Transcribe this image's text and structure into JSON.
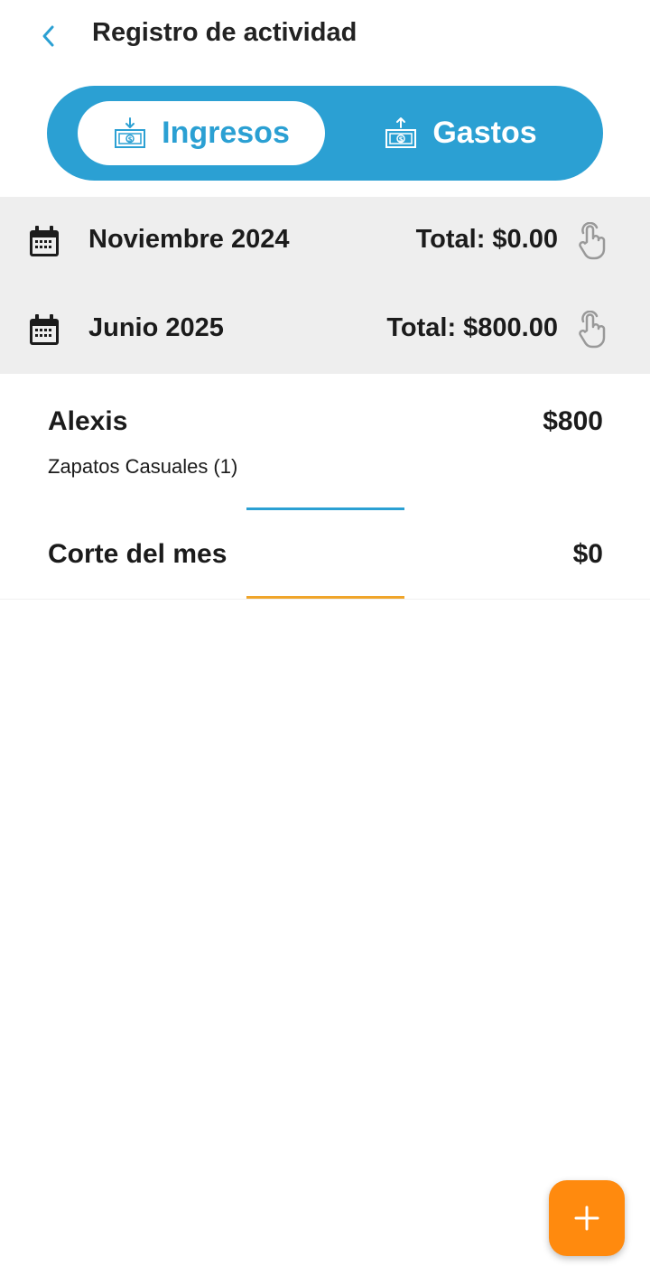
{
  "header": {
    "title": "Registro de actividad",
    "back_icon": "chevron-left-icon"
  },
  "segmented": {
    "active_tab": "Ingresos",
    "tabs": [
      {
        "label": "Ingresos",
        "icon": "money-in-icon",
        "active": true
      },
      {
        "label": "Gastos",
        "icon": "money-out-icon",
        "active": false
      }
    ]
  },
  "months": [
    {
      "name": "Noviembre 2024",
      "total": "Total: $0.00"
    },
    {
      "name": "Junio 2025",
      "total": "Total: $800.00"
    }
  ],
  "entries": [
    {
      "name": "Alexis",
      "amount": "$800",
      "detail": "Zapatos Casuales (1)"
    },
    {
      "name": "Corte del mes",
      "amount": "$0"
    }
  ],
  "colors": {
    "accent_blue": "#2ba0d3",
    "accent_orange": "#ff8a0e",
    "month_background": "#eeeeee"
  },
  "fab": {
    "icon": "plus-icon"
  }
}
